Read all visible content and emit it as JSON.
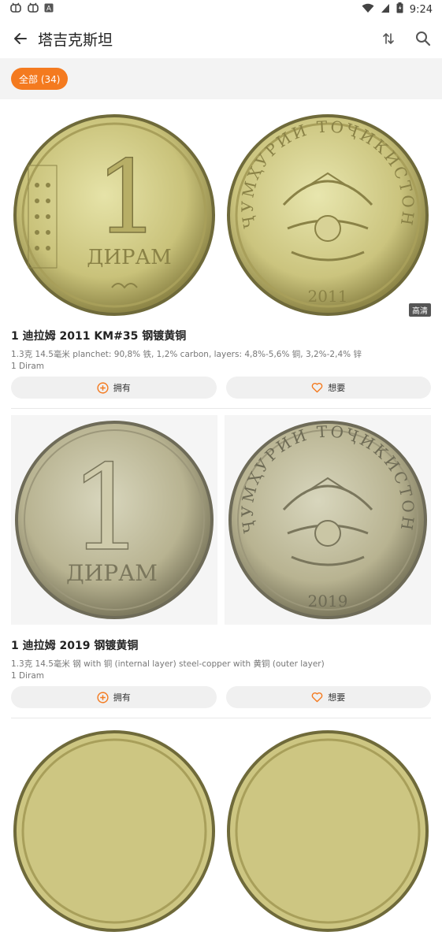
{
  "status": {
    "time": "9:24",
    "left_icons": [
      "bug-icon",
      "bug-icon",
      "a-badge-icon"
    ]
  },
  "appbar": {
    "title": "塔吉克斯坦"
  },
  "filter": {
    "chip_label": "全部 (34)"
  },
  "colors": {
    "accent": "#f47a1f",
    "hd_badge": "#555555"
  },
  "coins": [
    {
      "obverse_text": "1",
      "obverse_word": "ДИРАМ",
      "reverse_text": "ҶУМҲУРИИ ТОҶИКИСТОН",
      "reverse_year": "2011",
      "badge": "高清",
      "title": "1 迪拉姆  2011  KM#35  钢镀黄铜",
      "meta": "1.3克  14.5毫米  planchet: 90,8% 铁, 1,2% carbon, layers: 4,8%-5,6% 铜, 3,2%-2,4% 锌",
      "sub": "1 Diram",
      "own_label": "拥有",
      "want_label": "想要"
    },
    {
      "obverse_text": "1",
      "obverse_word": "ДИРАМ",
      "reverse_text": "ҶУМҲУРИИ ТОҶИКИСТОН",
      "reverse_year": "2019",
      "title": "1 迪拉姆  2019  钢镀黄铜",
      "meta": "1.3克  14.5毫米  钢 with 铜 (internal layer) steel-copper with 黄铜 (outer layer)",
      "sub": "1 Diram",
      "own_label": "拥有",
      "want_label": "想要"
    }
  ]
}
